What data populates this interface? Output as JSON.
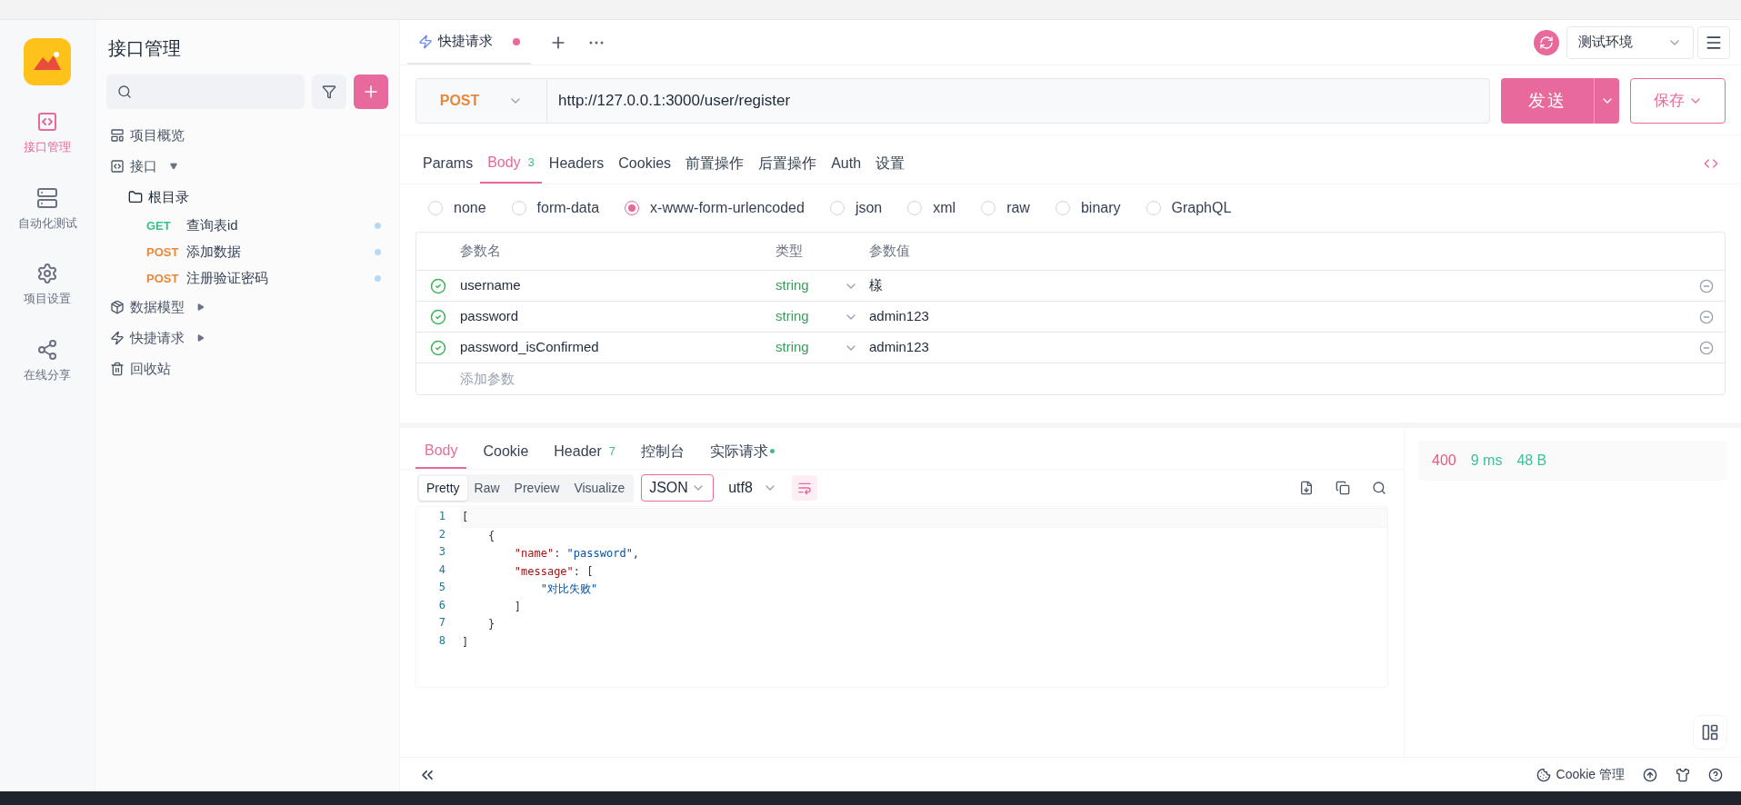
{
  "rail": [
    {
      "label": "接口管理",
      "selected": true
    },
    {
      "label": "自动化测试",
      "selected": false
    },
    {
      "label": "项目设置",
      "selected": false
    },
    {
      "label": "在线分享",
      "selected": false
    }
  ],
  "sidebar": {
    "title": "接口管理",
    "items": [
      {
        "kind": "overview",
        "label": "项目概览"
      },
      {
        "kind": "group",
        "label": "接口",
        "expanded": true,
        "children": [
          {
            "kind": "folder",
            "label": "根目录",
            "children": [
              {
                "kind": "api",
                "method": "GET",
                "label": "查询表id"
              },
              {
                "kind": "api",
                "method": "POST",
                "label": "添加数据"
              },
              {
                "kind": "api",
                "method": "POST",
                "label": "注册验证密码"
              }
            ]
          }
        ]
      },
      {
        "kind": "model",
        "label": "数据模型",
        "expanded": false
      },
      {
        "kind": "quick",
        "label": "快捷请求",
        "expanded": false
      },
      {
        "kind": "trash",
        "label": "回收站"
      }
    ]
  },
  "doc_tabs": [
    {
      "label": "快捷请求",
      "unsaved": true,
      "selected": true
    }
  ],
  "environment": "测试环境",
  "request": {
    "method": "POST",
    "url": "http://127.0.0.1:3000/user/register",
    "send": "发送",
    "save": "保存"
  },
  "request_tabs": [
    {
      "label": "Params",
      "selected": false
    },
    {
      "label": "Body",
      "count": "3",
      "selected": true
    },
    {
      "label": "Headers",
      "selected": false
    },
    {
      "label": "Cookies",
      "selected": false
    },
    {
      "label": "前置操作",
      "selected": false
    },
    {
      "label": "后置操作",
      "selected": false
    },
    {
      "label": "Auth",
      "selected": false
    },
    {
      "label": "设置",
      "selected": false
    }
  ],
  "body_types": [
    {
      "label": "none",
      "selected": false
    },
    {
      "label": "form-data",
      "selected": false
    },
    {
      "label": "x-www-form-urlencoded",
      "selected": true
    },
    {
      "label": "json",
      "selected": false
    },
    {
      "label": "xml",
      "selected": false
    },
    {
      "label": "raw",
      "selected": false
    },
    {
      "label": "binary",
      "selected": false
    },
    {
      "label": "GraphQL",
      "selected": false
    }
  ],
  "params": {
    "columns": [
      "参数名",
      "类型",
      "参数值"
    ],
    "rows": [
      {
        "enabled": true,
        "name": "username",
        "type": "string",
        "value": "樣"
      },
      {
        "enabled": true,
        "name": "password",
        "type": "string",
        "value": "admin123"
      },
      {
        "enabled": true,
        "name": "password_isConfirmed",
        "type": "string",
        "value": "admin123"
      }
    ],
    "add_placeholder": "添加参数"
  },
  "response_tabs": [
    {
      "label": "Body",
      "selected": true
    },
    {
      "label": "Cookie",
      "selected": false
    },
    {
      "label": "Header",
      "count": "7",
      "selected": false
    },
    {
      "label": "控制台",
      "selected": false
    },
    {
      "label": "实际请求",
      "dot": true,
      "selected": false
    }
  ],
  "view_modes": [
    {
      "label": "Pretty",
      "selected": true
    },
    {
      "label": "Raw",
      "selected": false
    },
    {
      "label": "Preview",
      "selected": false
    },
    {
      "label": "Visualize",
      "selected": false
    }
  ],
  "format": "JSON",
  "encoding": "utf8",
  "code_lines": [
    [
      {
        "kind": "punct",
        "text": "["
      }
    ],
    [
      {
        "kind": "punct",
        "text": "    {"
      }
    ],
    [
      {
        "kind": "key",
        "text": "        \"name\""
      },
      {
        "kind": "punct",
        "text": ": "
      },
      {
        "kind": "string",
        "text": "\"password\""
      },
      {
        "kind": "punct",
        "text": ","
      }
    ],
    [
      {
        "kind": "key",
        "text": "        \"message\""
      },
      {
        "kind": "punct",
        "text": ": ["
      }
    ],
    [
      {
        "kind": "string",
        "text": "            \"对比失败\""
      }
    ],
    [
      {
        "kind": "punct",
        "text": "        ]"
      }
    ],
    [
      {
        "kind": "punct",
        "text": "    }"
      }
    ],
    [
      {
        "kind": "punct",
        "text": "]"
      }
    ]
  ],
  "line_numbers": [
    "1",
    "2",
    "3",
    "4",
    "5",
    "6",
    "7",
    "8"
  ],
  "status": {
    "code": "400",
    "time": "9 ms",
    "size": "48 B"
  },
  "footer": {
    "cookie": "Cookie 管理"
  }
}
